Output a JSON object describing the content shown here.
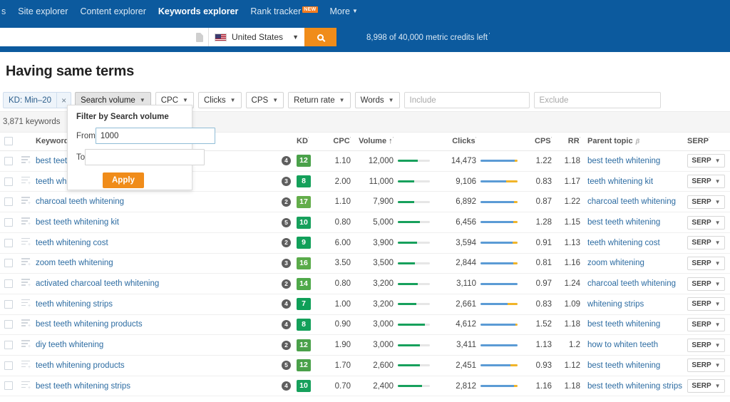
{
  "nav": {
    "stub": "s",
    "items": [
      {
        "label": "Site explorer",
        "active": false,
        "badge": null
      },
      {
        "label": "Content explorer",
        "active": false,
        "badge": null
      },
      {
        "label": "Keywords explorer",
        "active": true,
        "badge": null
      },
      {
        "label": "Rank tracker",
        "active": false,
        "badge": "NEW"
      },
      {
        "label": "More",
        "active": false,
        "badge": null,
        "caret": true
      }
    ]
  },
  "search": {
    "value": "",
    "placeholder": "",
    "country": "United States",
    "doc_icon": "document-icon",
    "search_icon": "search-icon",
    "credits": "8,998 of 40,000 metric credits left"
  },
  "page": {
    "title": "Having same terms",
    "keyword_count": "3,871 keywords"
  },
  "filters": {
    "kd_chip": {
      "label": "KD: Min–20",
      "close": "×"
    },
    "chips": [
      {
        "label": "Search volume",
        "active": true
      },
      {
        "label": "CPC",
        "active": false
      },
      {
        "label": "Clicks",
        "active": false
      },
      {
        "label": "CPS",
        "active": false
      },
      {
        "label": "Return rate",
        "active": false
      },
      {
        "label": "Words",
        "active": false
      }
    ],
    "include_placeholder": "Include",
    "include_value": "",
    "exclude_placeholder": "Exclude",
    "exclude_value": ""
  },
  "sv_panel": {
    "title": "Filter by Search volume",
    "from_label": "From",
    "from_value": "1000",
    "to_label": "To",
    "to_value": "",
    "apply_label": "Apply"
  },
  "table": {
    "headers": {
      "keyword": "Keyword",
      "kd": "KD",
      "cpc": "CPC",
      "volume": "Volume ↑",
      "clicks": "Clicks",
      "cps": "CPS",
      "rr": "RR",
      "parent_topic": "Parent topic",
      "serp": "SERP"
    },
    "serp_button": "SERP",
    "rows": [
      {
        "keyword": "best teeth whitening",
        "sf": "4",
        "kd": "12",
        "kd_color": "#4aa14a",
        "cpc": "1.10",
        "volume": "12,000",
        "volume_pct": 62,
        "clicks": "14,473",
        "clicks_blue_pct": 92,
        "clicks_yellow_pct": 8,
        "cps": "1.22",
        "rr": "1.18",
        "parent_topic": "best teeth whitening"
      },
      {
        "keyword": "teeth whitening kit",
        "sf": "3",
        "kd": "8",
        "kd_color": "#14a05a",
        "cpc": "2.00",
        "volume": "11,000",
        "volume_pct": 50,
        "clicks": "9,106",
        "clicks_blue_pct": 70,
        "clicks_yellow_pct": 30,
        "cps": "0.83",
        "rr": "1.17",
        "parent_topic": "teeth whitening kit"
      },
      {
        "keyword": "charcoal teeth whitening",
        "sf": "2",
        "kd": "17",
        "kd_color": "#63ad4a",
        "cpc": "1.10",
        "volume": "7,900",
        "volume_pct": 52,
        "clicks": "6,892",
        "clicks_blue_pct": 90,
        "clicks_yellow_pct": 10,
        "cps": "0.87",
        "rr": "1.22",
        "parent_topic": "charcoal teeth whitening"
      },
      {
        "keyword": "best teeth whitening kit",
        "sf": "5",
        "kd": "10",
        "kd_color": "#17a05c",
        "cpc": "0.80",
        "volume": "5,000",
        "volume_pct": 68,
        "clicks": "6,456",
        "clicks_blue_pct": 88,
        "clicks_yellow_pct": 12,
        "cps": "1.28",
        "rr": "1.15",
        "parent_topic": "best teeth whitening"
      },
      {
        "keyword": "teeth whitening cost",
        "sf": "2",
        "kd": "9",
        "kd_color": "#11a05a",
        "cpc": "6.00",
        "volume": "3,900",
        "volume_pct": 60,
        "clicks": "3,594",
        "clicks_blue_pct": 86,
        "clicks_yellow_pct": 14,
        "cps": "0.91",
        "rr": "1.13",
        "parent_topic": "teeth whitening cost"
      },
      {
        "keyword": "zoom teeth whitening",
        "sf": "3",
        "kd": "16",
        "kd_color": "#5aab4a",
        "cpc": "3.50",
        "volume": "3,500",
        "volume_pct": 54,
        "clicks": "2,844",
        "clicks_blue_pct": 88,
        "clicks_yellow_pct": 12,
        "cps": "0.81",
        "rr": "1.16",
        "parent_topic": "zoom whitening"
      },
      {
        "keyword": "activated charcoal teeth whitening",
        "sf": "2",
        "kd": "14",
        "kd_color": "#4fa94a",
        "cpc": "0.80",
        "volume": "3,200",
        "volume_pct": 62,
        "clicks": "3,110",
        "clicks_blue_pct": 100,
        "clicks_yellow_pct": 0,
        "cps": "0.97",
        "rr": "1.24",
        "parent_topic": "charcoal teeth whitening"
      },
      {
        "keyword": "teeth whitening strips",
        "sf": "4",
        "kd": "7",
        "kd_color": "#0f9f58",
        "cpc": "1.00",
        "volume": "3,200",
        "volume_pct": 58,
        "clicks": "2,661",
        "clicks_blue_pct": 74,
        "clicks_yellow_pct": 26,
        "cps": "0.83",
        "rr": "1.09",
        "parent_topic": "whitening strips"
      },
      {
        "keyword": "best teeth whitening products",
        "sf": "4",
        "kd": "8",
        "kd_color": "#14a05a",
        "cpc": "0.90",
        "volume": "3,000",
        "volume_pct": 84,
        "clicks": "4,612",
        "clicks_blue_pct": 94,
        "clicks_yellow_pct": 6,
        "cps": "1.52",
        "rr": "1.18",
        "parent_topic": "best teeth whitening"
      },
      {
        "keyword": "diy teeth whitening",
        "sf": "2",
        "kd": "12",
        "kd_color": "#4aa14a",
        "cpc": "1.90",
        "volume": "3,000",
        "volume_pct": 68,
        "clicks": "3,411",
        "clicks_blue_pct": 100,
        "clicks_yellow_pct": 0,
        "cps": "1.13",
        "rr": "1.2",
        "parent_topic": "how to whiten teeth"
      },
      {
        "keyword": "teeth whitening products",
        "sf": "5",
        "kd": "12",
        "kd_color": "#4aa14a",
        "cpc": "1.70",
        "volume": "2,600",
        "volume_pct": 68,
        "clicks": "2,451",
        "clicks_blue_pct": 80,
        "clicks_yellow_pct": 20,
        "cps": "0.93",
        "rr": "1.12",
        "parent_topic": "best teeth whitening"
      },
      {
        "keyword": "best teeth whitening strips",
        "sf": "4",
        "kd": "10",
        "kd_color": "#17a05c",
        "cpc": "0.70",
        "volume": "2,400",
        "volume_pct": 76,
        "clicks": "2,812",
        "clicks_blue_pct": 90,
        "clicks_yellow_pct": 10,
        "cps": "1.16",
        "rr": "1.18",
        "parent_topic": "best teeth whitening strips"
      }
    ]
  },
  "colors": {
    "brand_blue": "#0c5a9e",
    "accent_orange": "#f08c1a",
    "link_blue": "#2d6ca2",
    "bar_green": "#17a05c",
    "bar_blue": "#5b9bd5",
    "bar_yellow": "#f0b429"
  }
}
